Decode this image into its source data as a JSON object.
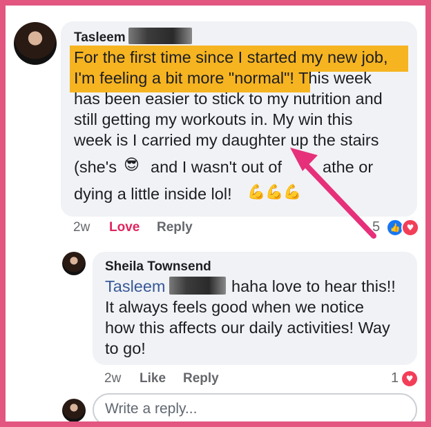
{
  "comment": {
    "author": "Tasleem",
    "lines": [
      "For the first time since I started my new job,",
      "I'm feeling a bit more \"normal\"! This week",
      "has been easier to stick to my nutrition and",
      "still getting my workouts in. My win this",
      "week is I carried my daughter up the stairs",
      "(she's",
      "and I wasn't out of",
      "athe or",
      "dying a little inside lol!"
    ],
    "sunglasses_emoji": "😎",
    "muscle_emoji": "💪💪💪",
    "time": "2w",
    "love_label": "Love",
    "reply_label": "Reply",
    "reaction_count": "5",
    "reaction_icons": [
      "like-icon",
      "heart-icon"
    ],
    "highlight_color": "#f6b421"
  },
  "reply": {
    "author": "Sheila Townsend",
    "mention": "Tasleem",
    "lines": [
      "haha love to hear this!!",
      "It always feels good when we notice",
      "how this affects our daily activities! Way",
      "to go!"
    ],
    "time": "2w",
    "like_label": "Like",
    "reply_label": "Reply",
    "reaction_count": "1",
    "reaction_icons": [
      "heart-icon"
    ]
  },
  "composer": {
    "placeholder": "Write a reply..."
  },
  "annotation": {
    "arrow_color": "#e6307a",
    "border_color": "#e2567f"
  }
}
